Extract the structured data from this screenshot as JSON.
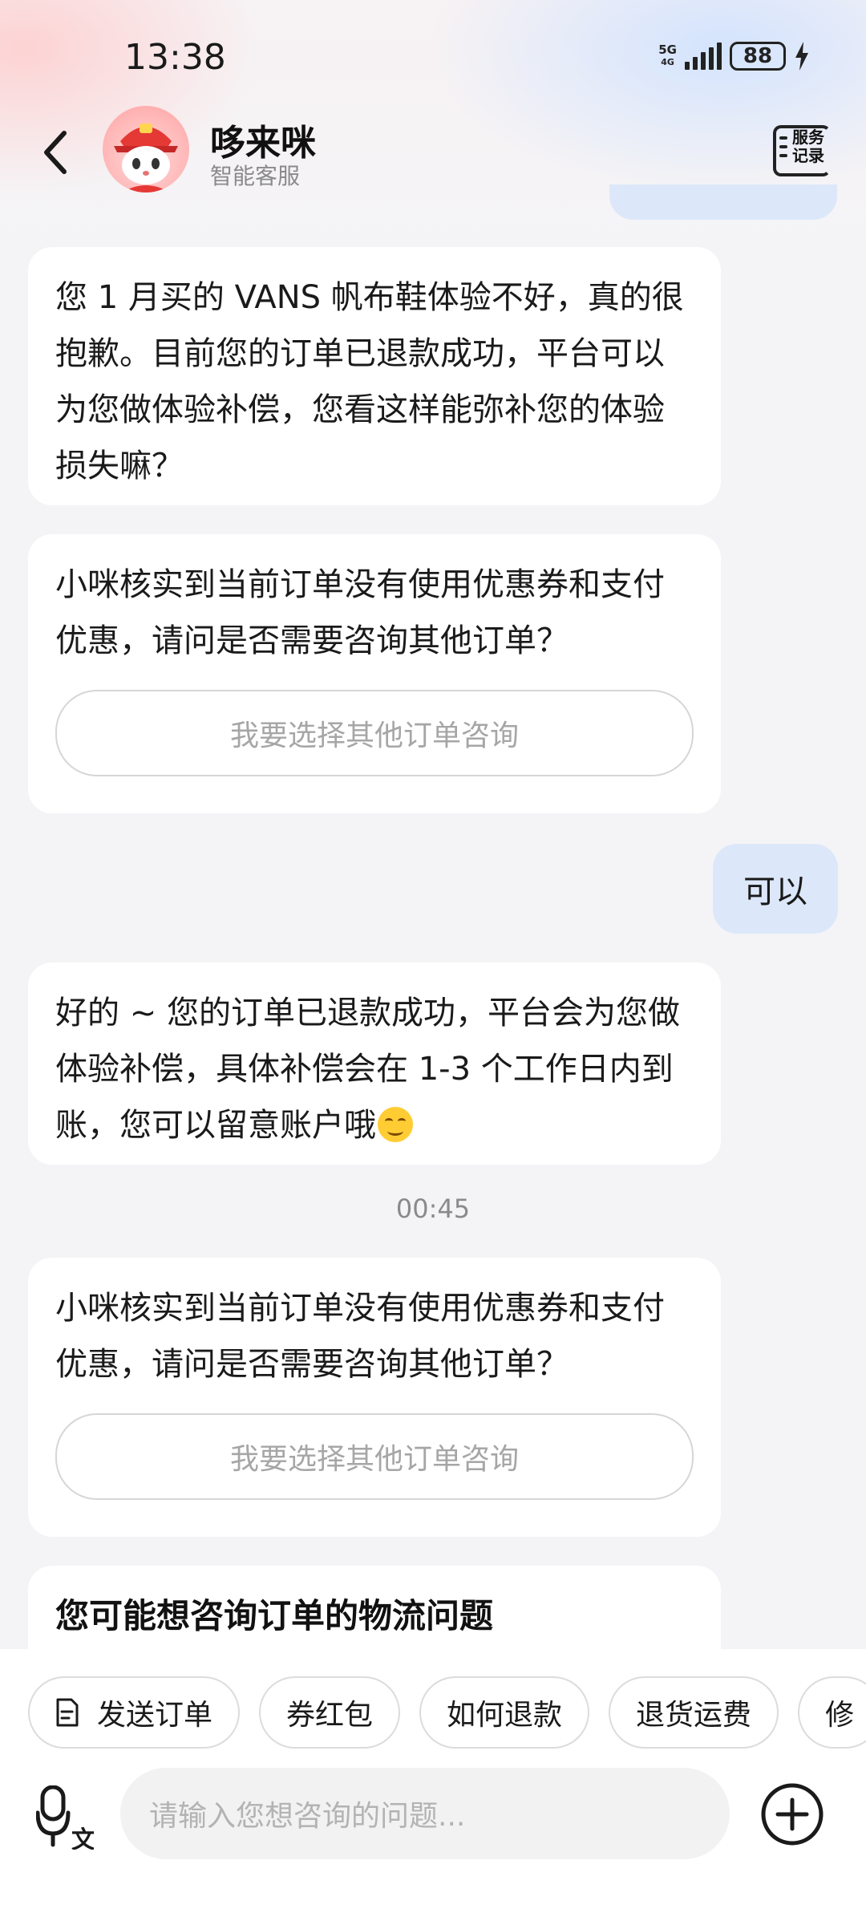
{
  "status_bar": {
    "time": "13:38",
    "network": "5G",
    "network_sub": "4G",
    "battery": "88"
  },
  "header": {
    "name": "哆来咪",
    "subtitle": "智能客服",
    "service_record_label": "服务记录"
  },
  "messages": [
    {
      "from": "agent",
      "text": "您 1 月买的 VANS 帆布鞋体验不好，真的很抱歉。目前您的订单已退款成功，平台可以为您做体验补偿，您看这样能弥补您的体验损失嘛？"
    },
    {
      "from": "agent",
      "text": "小咪核实到当前订单没有使用优惠券和支付优惠，请问是否需要咨询其他订单？",
      "button": "我要选择其他订单咨询"
    },
    {
      "from": "user",
      "text": "可以"
    },
    {
      "from": "agent",
      "text": "好的 ~ 您的订单已退款成功，平台会为您做体验补偿，具体补偿会在 1-3 个工作日内到账，您可以留意账户哦",
      "emoji": "smiling-face"
    },
    {
      "from": "system",
      "text": "00:45"
    },
    {
      "from": "agent",
      "text": "小咪核实到当前订单没有使用优惠券和支付优惠，请问是否需要咨询其他订单？",
      "button": "我要选择其他订单咨询"
    },
    {
      "from": "agent",
      "title": "您可能想咨询订单的物流问题"
    }
  ],
  "quick_actions": [
    "发送订单",
    "券红包",
    "如何退款",
    "退货运费",
    "修"
  ],
  "input": {
    "placeholder": "请输入您想咨询的问题..."
  }
}
